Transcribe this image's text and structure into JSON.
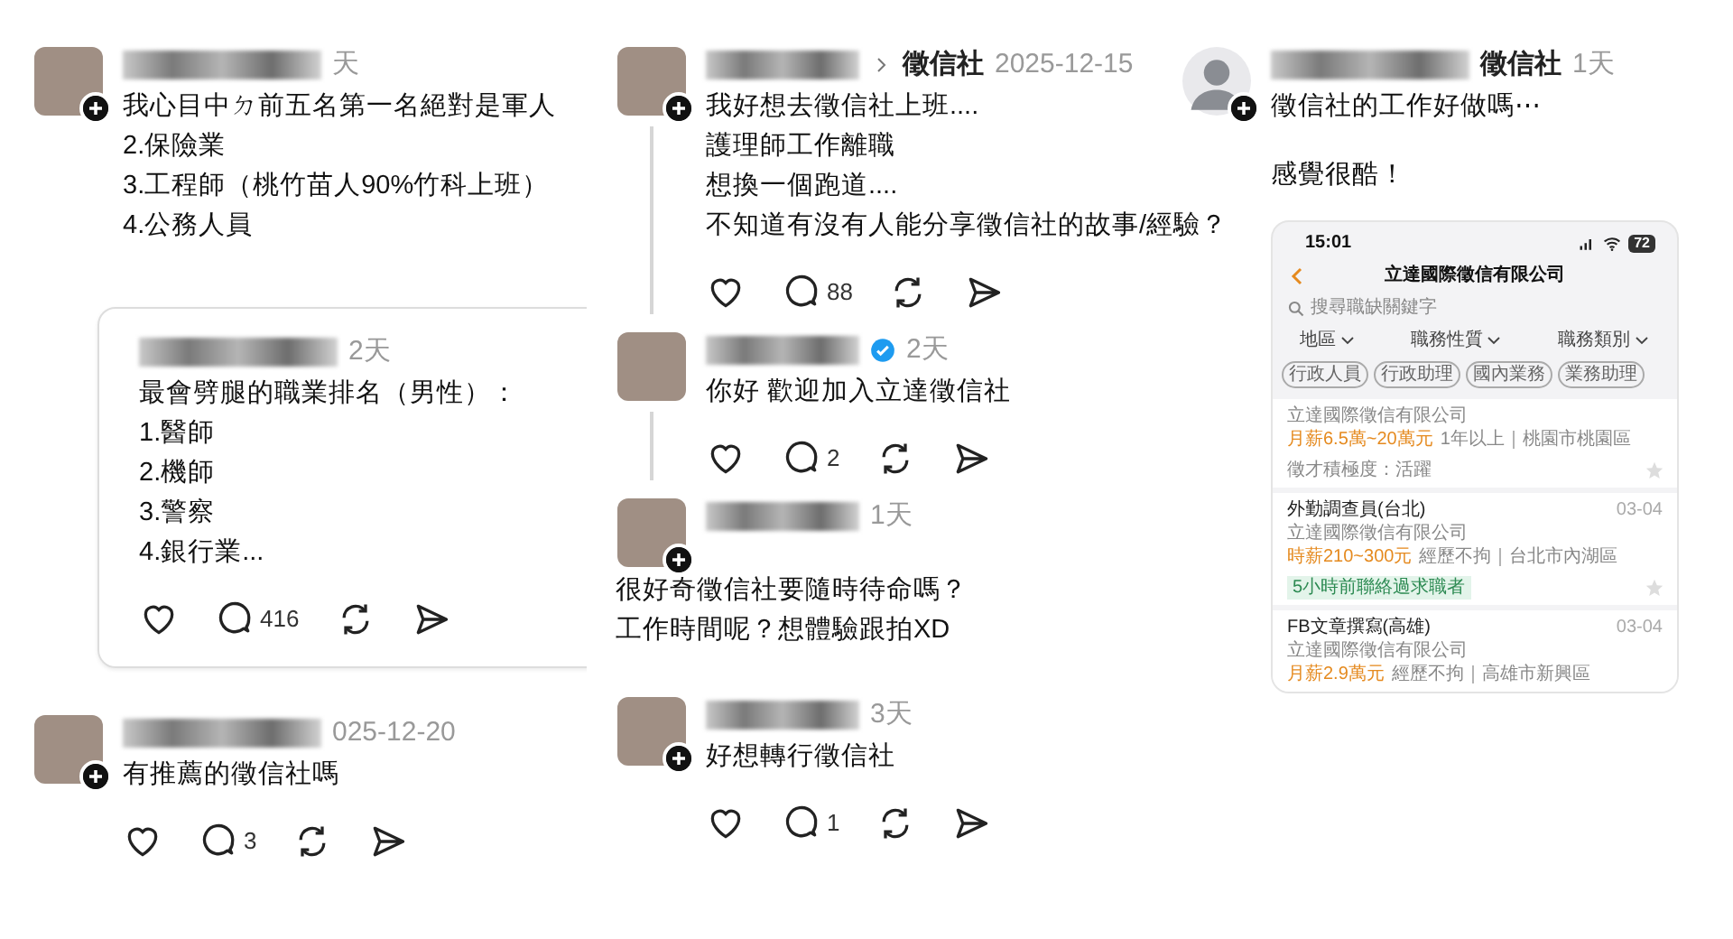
{
  "columns": [
    {
      "posts": [
        {
          "kind": "standard",
          "avatar": {
            "kind": "photo"
          },
          "follow_badge": true,
          "time": "天",
          "text": [
            [
              "我心目中ㄉ前五名第一名絕對是軍人",
              "2.保險業",
              "3.工程師（桃竹苗人90%竹科上班）",
              "4.公務人員"
            ]
          ],
          "quoted": {
            "time": "2天",
            "text": [
              [
                "最會劈腿的職業排名（男性）：",
                "1.醫師",
                "2.機師",
                "3.警察",
                "4.銀行業..."
              ]
            ],
            "actions": {
              "comments": "416"
            }
          }
        },
        {
          "kind": "standard",
          "avatar": {
            "kind": "photo"
          },
          "follow_badge": true,
          "time": "025-12-20",
          "text": [
            [
              "有推薦的徵信社嗎"
            ]
          ],
          "actions": {
            "comments": "3"
          }
        }
      ]
    },
    {
      "posts": [
        {
          "kind": "standard",
          "avatar": {
            "kind": "photo"
          },
          "follow_badge": true,
          "thread": true,
          "tag": "徵信社",
          "time": "2025-12-15",
          "text": [
            [
              "我好想去徵信社上班....",
              "護理師工作離職",
              "想換一個跑道....",
              "不知道有沒有人能分享徵信社的故事/經驗？"
            ]
          ],
          "actions": {
            "comments": "88"
          }
        },
        {
          "kind": "standard",
          "avatar": {
            "kind": "photo"
          },
          "follow_badge": false,
          "thread": true,
          "verified": true,
          "time": "2天",
          "text": [
            [
              "你好 歡迎加入立達徵信社"
            ]
          ],
          "actions": {
            "comments": "2"
          }
        },
        {
          "kind": "stacked",
          "avatar": {
            "kind": "photo"
          },
          "follow_badge": true,
          "time": "1天",
          "text": [
            [
              "很好奇徵信社要隨時待命嗎？",
              "工作時間呢？想體驗跟拍XD"
            ]
          ]
        },
        {
          "kind": "standard",
          "avatar": {
            "kind": "photo"
          },
          "follow_badge": true,
          "time": "3天",
          "text": [
            [
              "好想轉行徵信社"
            ]
          ],
          "actions": {
            "comments": "1"
          }
        }
      ]
    },
    {
      "posts": [
        {
          "kind": "standard",
          "avatar": {
            "kind": "default"
          },
          "follow_badge": true,
          "tag": "徵信社",
          "time": "1天",
          "text": [
            [
              "徵信社的工作好做嗎⋯"
            ],
            [
              "感覺很酷！"
            ]
          ],
          "phone": {
            "clock": "15:01",
            "battery": "72",
            "title": "立達國際徵信有限公司",
            "search_placeholder": "搜尋職缺關鍵字",
            "filters": [
              "地區",
              "職務性質",
              "職務類別"
            ],
            "tags": [
              "行政人員",
              "行政助理",
              "國內業務",
              "業務助理"
            ],
            "jobs": [
              {
                "company": "立達國際徵信有限公司",
                "salary": "月薪6.5萬~20萬元",
                "details": "1年以上｜桃園市桃園區",
                "note": {
                  "kind": "plain",
                  "text": "徵才積極度：活躍"
                },
                "starred": false
              },
              {
                "title": "外勤調查員(台北)",
                "date": "03-04",
                "company": "立達國際徵信有限公司",
                "salary": "時薪210~300元",
                "details": "經歷不拘｜台北市內湖區",
                "note": {
                  "kind": "badge",
                  "text": "5小時前聯絡過求職者"
                },
                "starred": false
              },
              {
                "title": "FB文章撰寫(高雄)",
                "date": "03-04",
                "company": "立達國際徵信有限公司",
                "salary": "月薪2.9萬元",
                "details": "經歷不拘｜高雄市新興區"
              }
            ]
          }
        }
      ]
    }
  ]
}
